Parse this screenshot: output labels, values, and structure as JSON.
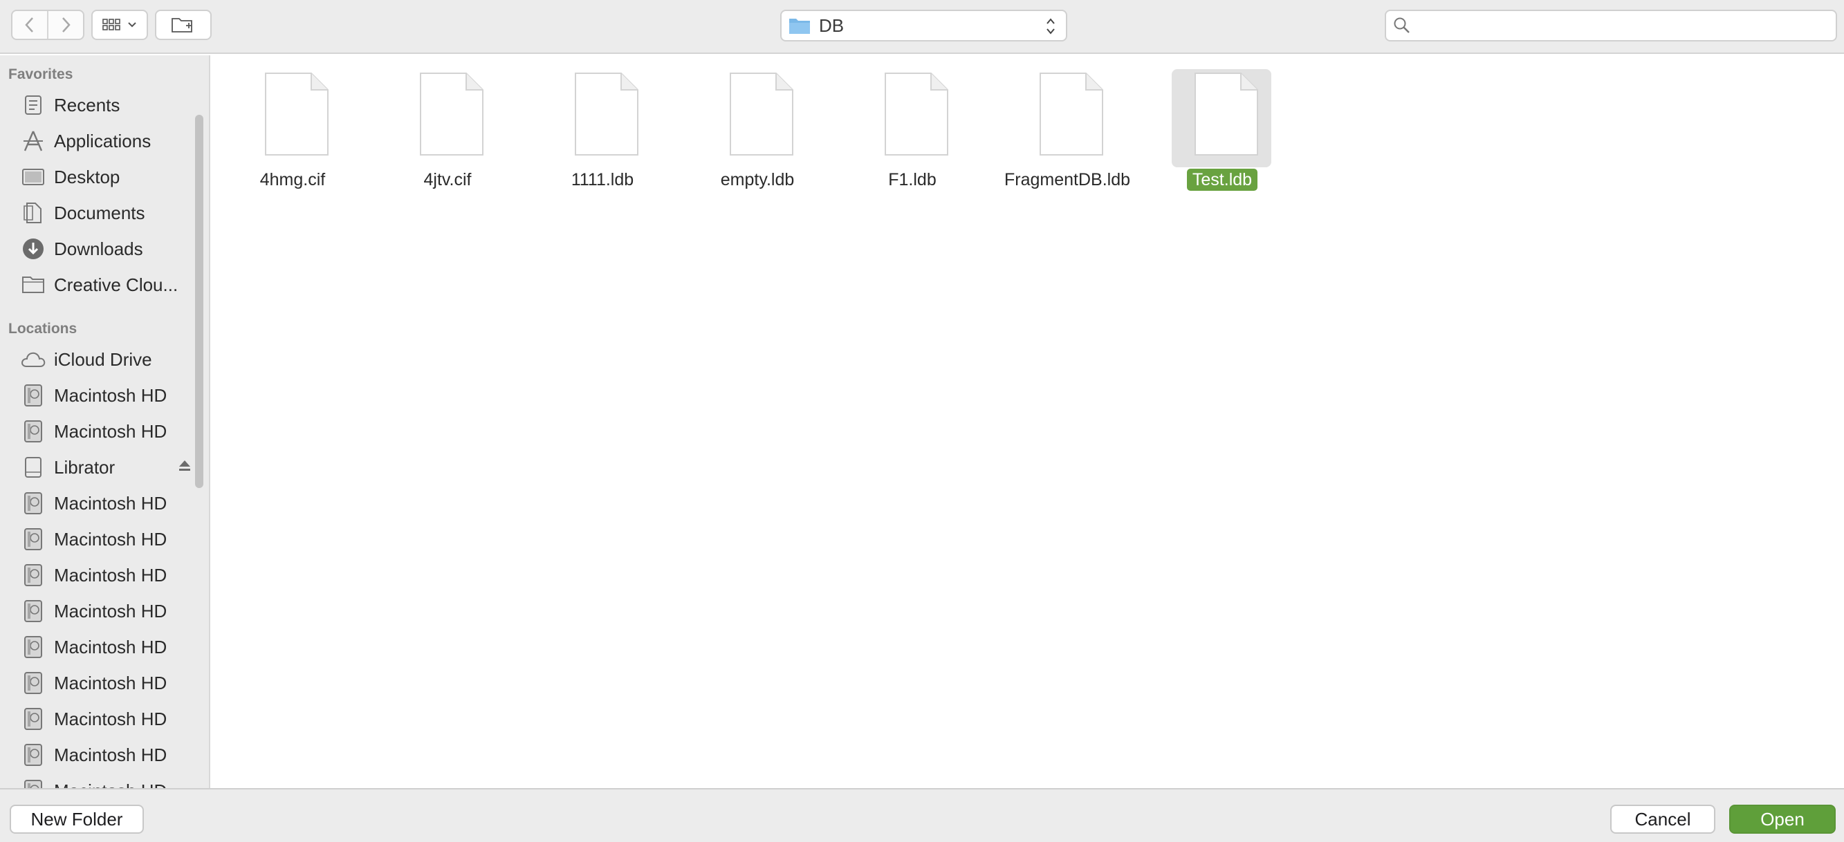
{
  "toolbar": {
    "back_icon": "chevron-left-icon",
    "forward_icon": "chevron-right-icon",
    "view_icon": "grid-view-icon",
    "new_folder_icon": "new-folder-icon",
    "path_label": "DB",
    "search_placeholder": ""
  },
  "sidebar": {
    "favorites_heading": "Favorites",
    "favorites": [
      {
        "label": "Recents",
        "icon": "clock-icon"
      },
      {
        "label": "Applications",
        "icon": "applications-icon"
      },
      {
        "label": "Desktop",
        "icon": "desktop-icon"
      },
      {
        "label": "Documents",
        "icon": "document-icon"
      },
      {
        "label": "Downloads",
        "icon": "download-icon"
      },
      {
        "label": "Creative Clou...",
        "icon": "folder-icon"
      }
    ],
    "locations_heading": "Locations",
    "locations": [
      {
        "label": "iCloud Drive",
        "icon": "cloud-icon"
      },
      {
        "label": "Macintosh HD",
        "icon": "hard-drive-icon"
      },
      {
        "label": "Macintosh HD",
        "icon": "hard-drive-icon"
      },
      {
        "label": "Librator",
        "icon": "external-drive-icon"
      },
      {
        "label": "Macintosh HD",
        "icon": "hard-drive-icon"
      },
      {
        "label": "Macintosh HD",
        "icon": "hard-drive-icon"
      },
      {
        "label": "Macintosh HD",
        "icon": "hard-drive-icon"
      },
      {
        "label": "Macintosh HD",
        "icon": "hard-drive-icon"
      },
      {
        "label": "Macintosh HD",
        "icon": "hard-drive-icon"
      },
      {
        "label": "Macintosh HD",
        "icon": "hard-drive-icon"
      },
      {
        "label": "Macintosh HD",
        "icon": "hard-drive-icon"
      },
      {
        "label": "Macintosh HD",
        "icon": "hard-drive-icon"
      },
      {
        "label": "Macintosh HD",
        "icon": "hard-drive-icon"
      }
    ]
  },
  "files": [
    {
      "name": "4hmg.cif",
      "selected": false
    },
    {
      "name": "4jtv.cif",
      "selected": false
    },
    {
      "name": "1111.ldb",
      "selected": false
    },
    {
      "name": "empty.ldb",
      "selected": false
    },
    {
      "name": "F1.ldb",
      "selected": false
    },
    {
      "name": "FragmentDB.ldb",
      "selected": false
    },
    {
      "name": "Test.ldb",
      "selected": true
    }
  ],
  "footer": {
    "new_folder_label": "New Folder",
    "cancel_label": "Cancel",
    "open_label": "Open"
  },
  "colors": {
    "accent": "#5f9f3a",
    "selection_label": "#69a240",
    "folder_blue": "#7ab8e8"
  }
}
